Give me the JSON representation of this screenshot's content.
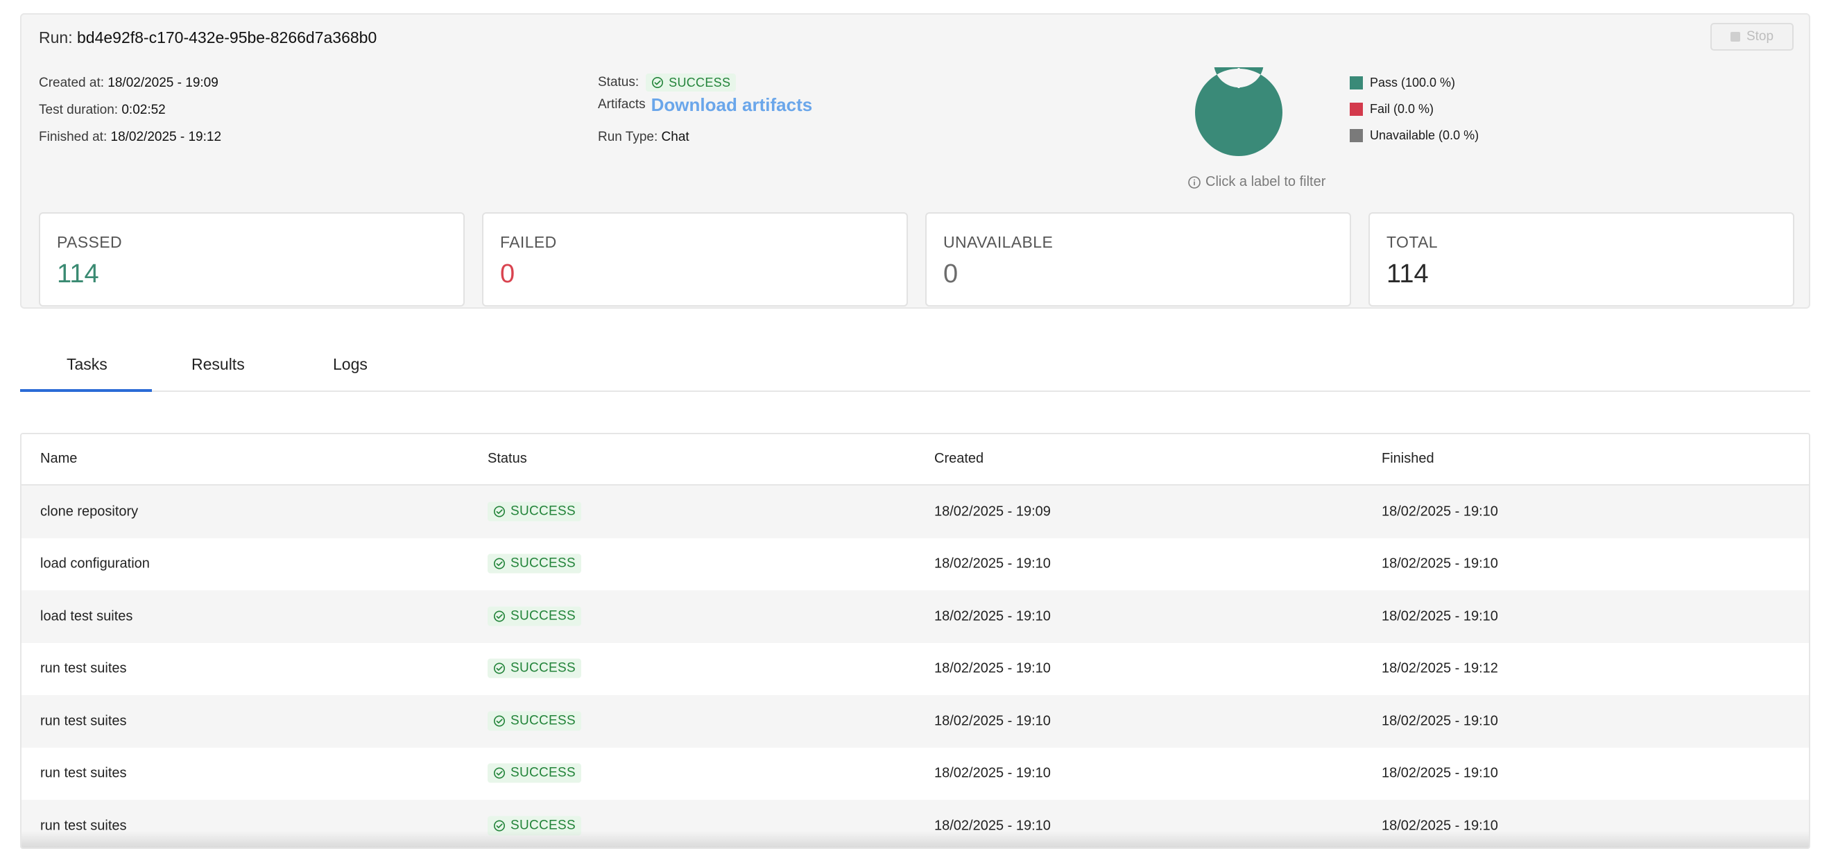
{
  "run": {
    "label": "Run:",
    "id": "bd4e92f8-c170-432e-95be-8266d7a368b0",
    "stop_label": "Stop",
    "created_label": "Created at:",
    "created_value": "18/02/2025 - 19:09",
    "duration_label": "Test duration:",
    "duration_value": "0:02:52",
    "finished_label": "Finished at:",
    "finished_value": "18/02/2025 - 19:12",
    "status_label": "Status:",
    "status_value": "SUCCESS",
    "artifacts_label": "Artifacts",
    "artifacts_link": "Download artifacts",
    "run_type_label": "Run Type:",
    "run_type_value": "Chat"
  },
  "chart_data": {
    "type": "pie",
    "categories": [
      "Pass (100.0 %)",
      "Fail (0.0 %)",
      "Unavailable (0.0 %)"
    ],
    "values": [
      100.0,
      0.0,
      0.0
    ],
    "colors": [
      "#3a8a78",
      "#d33a4c",
      "#7a7a7a"
    ],
    "legend": "right",
    "hint": "Click a label to filter"
  },
  "cards": [
    {
      "label": "PASSED",
      "value": "114",
      "color": "#3a8a72"
    },
    {
      "label": "FAILED",
      "value": "0",
      "color": "#d9434f"
    },
    {
      "label": "UNAVAILABLE",
      "value": "0",
      "color": "#6c6c6c"
    },
    {
      "label": "TOTAL",
      "value": "114",
      "color": "#2a2a2a"
    }
  ],
  "tabs": [
    {
      "label": "Tasks",
      "active": true
    },
    {
      "label": "Results",
      "active": false
    },
    {
      "label": "Logs",
      "active": false
    }
  ],
  "table": {
    "headers": [
      "Name",
      "Status",
      "Created",
      "Finished"
    ],
    "rows": [
      {
        "name": "clone repository",
        "status": "SUCCESS",
        "created": "18/02/2025 - 19:09",
        "finished": "18/02/2025 - 19:10"
      },
      {
        "name": "load configuration",
        "status": "SUCCESS",
        "created": "18/02/2025 - 19:10",
        "finished": "18/02/2025 - 19:10"
      },
      {
        "name": "load test suites",
        "status": "SUCCESS",
        "created": "18/02/2025 - 19:10",
        "finished": "18/02/2025 - 19:10"
      },
      {
        "name": "run test suites",
        "status": "SUCCESS",
        "created": "18/02/2025 - 19:10",
        "finished": "18/02/2025 - 19:12"
      },
      {
        "name": "run test suites",
        "status": "SUCCESS",
        "created": "18/02/2025 - 19:10",
        "finished": "18/02/2025 - 19:10"
      },
      {
        "name": "run test suites",
        "status": "SUCCESS",
        "created": "18/02/2025 - 19:10",
        "finished": "18/02/2025 - 19:10"
      },
      {
        "name": "run test suites",
        "status": "SUCCESS",
        "created": "18/02/2025 - 19:10",
        "finished": "18/02/2025 - 19:10"
      }
    ]
  },
  "icons": {
    "status": "check-circle-icon",
    "stop": "stop-square-icon",
    "info": "info-circle-icon"
  }
}
